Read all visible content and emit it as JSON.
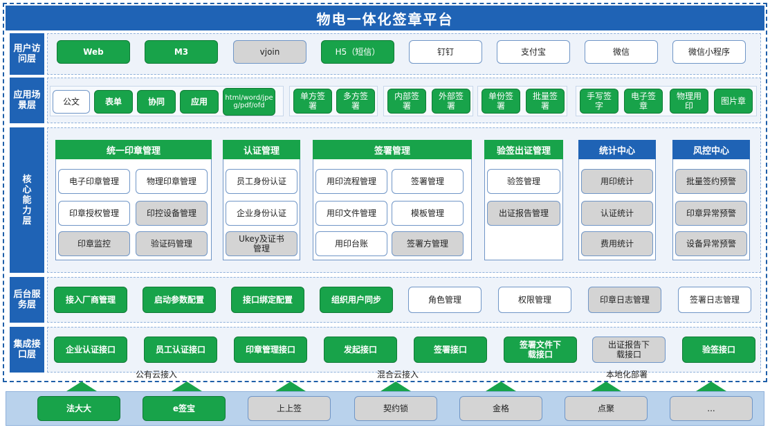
{
  "title": "物电一体化签章平台",
  "layers": {
    "access": "用户访问层",
    "scene": "应用场景层",
    "core": "核心能力层",
    "backend": "后台服务层",
    "integration": "集成接口层"
  },
  "access_items": [
    "Web",
    "M3",
    "vjoin",
    "H5（短信）",
    "钉钉",
    "支付宝",
    "微信",
    "微信小程序"
  ],
  "scene_items": {
    "docs": [
      "公文",
      "表单",
      "协同",
      "应用",
      "html/word/jpeg/pdf/ofd"
    ],
    "modes": [
      "单方签署",
      "多方签署",
      "内部签署",
      "外部签署",
      "单份签署",
      "批量签署",
      "手写签字",
      "电子签章",
      "物理用印",
      "图片章"
    ]
  },
  "core": {
    "seal_mgmt": {
      "title": "统一印章管理",
      "items": [
        "电子印章管理",
        "物理印章管理",
        "印章授权管理",
        "印控设备管理",
        "印章监控",
        "验证码管理"
      ]
    },
    "auth_mgmt": {
      "title": "认证管理",
      "items": [
        "员工身份认证",
        "企业身份认证",
        "Ukey及证书管理"
      ]
    },
    "sign_mgmt": {
      "title": "签署管理",
      "items": [
        "用印流程管理",
        "签署管理",
        "用印文件管理",
        "模板管理",
        "用印台账",
        "签署方管理"
      ]
    },
    "verify_mgmt": {
      "title": "验签出证管理",
      "items": [
        "验签管理",
        "出证报告管理"
      ]
    },
    "stats": {
      "title": "统计中心",
      "items": [
        "用印统计",
        "认证统计",
        "费用统计"
      ]
    },
    "risk": {
      "title": "风控中心",
      "items": [
        "批量签约预警",
        "印章异常预警",
        "设备异常预警"
      ]
    }
  },
  "backend_items": [
    "接入厂商管理",
    "启动参数配置",
    "接口绑定配置",
    "组织用户同步",
    "角色管理",
    "权限管理",
    "印章日志管理",
    "签署日志管理"
  ],
  "integration_items": [
    "企业认证接口",
    "员工认证接口",
    "印章管理接口",
    "发起接口",
    "签署接口",
    "签署文件下载接口",
    "出证报告下载接口",
    "验签接口"
  ],
  "cloud_labels": [
    "公有云接入",
    "混合云接入",
    "本地化部署"
  ],
  "vendors": [
    "法大大",
    "e签宝",
    "上上签",
    "契约锁",
    "金格",
    "点聚",
    "..."
  ]
}
